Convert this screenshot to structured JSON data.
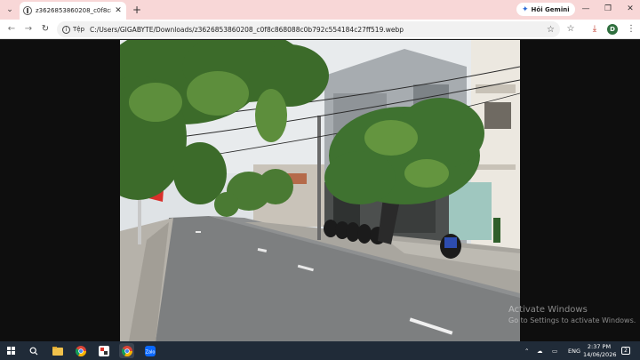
{
  "browser": {
    "tab": {
      "title": "z3626853860208_c0f8c86808...",
      "close_icon": "close-icon",
      "favicon": "globe-icon"
    },
    "new_tab_icon": "plus-icon",
    "gemini_button": {
      "label": "Hỏi Gemini",
      "icon": "gemini-sparkle-icon"
    },
    "window_controls": [
      "minimize-icon",
      "restore-icon",
      "close-icon"
    ],
    "toolbar": {
      "site_info_label": "Tệp",
      "url": "C:/Users/GIGABYTE/Downloads/z3626853860208_c0f8c868088c0b792c554184c27ff519.webp",
      "profile_initial": "D"
    }
  },
  "watermark": {
    "title": "Activate Windows",
    "subtitle": "Go to Settings to activate Windows."
  },
  "taskbar": {
    "language": "ENG",
    "time": "2:37 PM",
    "date": "14/06/2026",
    "notification_count": "2",
    "apps": [
      "windows-start-icon",
      "search-icon",
      "file-explorer-icon",
      "chrome-icon",
      "app-icon",
      "chrome-icon",
      "zalo-icon"
    ]
  },
  "colors": {
    "tab_strip": "#f8d7d7",
    "taskbar": "#202b38",
    "viewer_bg": "#0e0e0e"
  }
}
